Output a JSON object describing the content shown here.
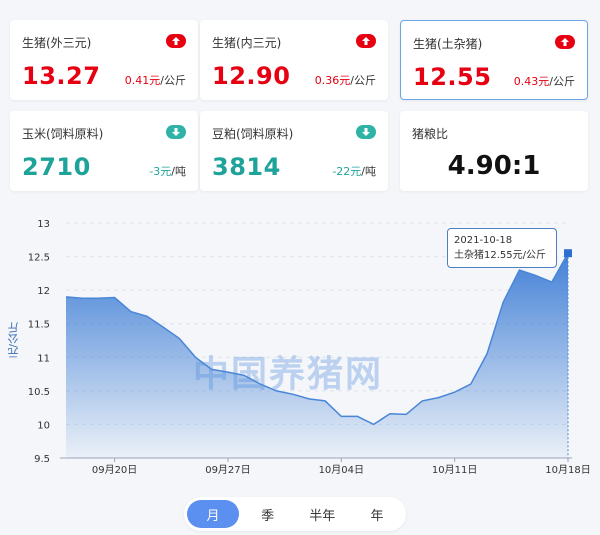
{
  "cards": [
    {
      "name": "生猪(外三元)",
      "price": "13.27",
      "change": "0.41元",
      "unit": "/公斤",
      "trend": "up"
    },
    {
      "name": "生猪(内三元)",
      "price": "12.90",
      "change": "0.36元",
      "unit": "/公斤",
      "trend": "up"
    },
    {
      "name": "生猪(土杂猪)",
      "price": "12.55",
      "change": "0.43元",
      "unit": "/公斤",
      "trend": "up"
    },
    {
      "name": "玉米(饲料原料)",
      "price": "2710",
      "change": "-3元",
      "unit": "/吨",
      "trend": "down"
    },
    {
      "name": "豆粕(饲料原料)",
      "price": "3814",
      "change": "-22元",
      "unit": "/吨",
      "trend": "down"
    },
    {
      "name": "猪粮比",
      "ratio": "4.90:1"
    }
  ],
  "colors": {
    "up": "#e60012",
    "down": "#1ea39a",
    "line": "#4a86d8",
    "accent": "#5b8ff0"
  },
  "watermark": "中国养猪网",
  "tooltip": {
    "date": "2021-10-18",
    "text": "土杂猪12.55元/公斤"
  },
  "period_tabs": [
    {
      "label": "月",
      "active": true
    },
    {
      "label": "季",
      "active": false
    },
    {
      "label": "半年",
      "active": false
    },
    {
      "label": "年",
      "active": false
    }
  ],
  "chart_data": {
    "type": "area",
    "ylabel": "元/公斤",
    "ylim": [
      9.5,
      13
    ],
    "yticks": [
      9.5,
      10,
      10.5,
      11,
      11.5,
      12,
      12.5,
      13
    ],
    "grid": true,
    "x_tick_labels": [
      {
        "label": "09月20日",
        "index": 3
      },
      {
        "label": "09月27日",
        "index": 10
      },
      {
        "label": "10月04日",
        "index": 17
      },
      {
        "label": "10月11日",
        "index": 24
      },
      {
        "label": "10月18日",
        "index": 31
      }
    ],
    "series": [
      {
        "values": [
          11.9,
          11.88,
          11.88,
          11.89,
          11.68,
          11.61,
          11.45,
          11.28,
          11.0,
          10.82,
          10.78,
          10.73,
          10.6,
          10.5,
          10.45,
          10.38,
          10.35,
          10.12,
          10.12,
          10.0,
          10.16,
          10.15,
          10.35,
          10.4,
          10.48,
          10.6,
          11.05,
          11.82,
          12.3,
          12.22,
          12.12,
          12.55
        ]
      }
    ]
  }
}
